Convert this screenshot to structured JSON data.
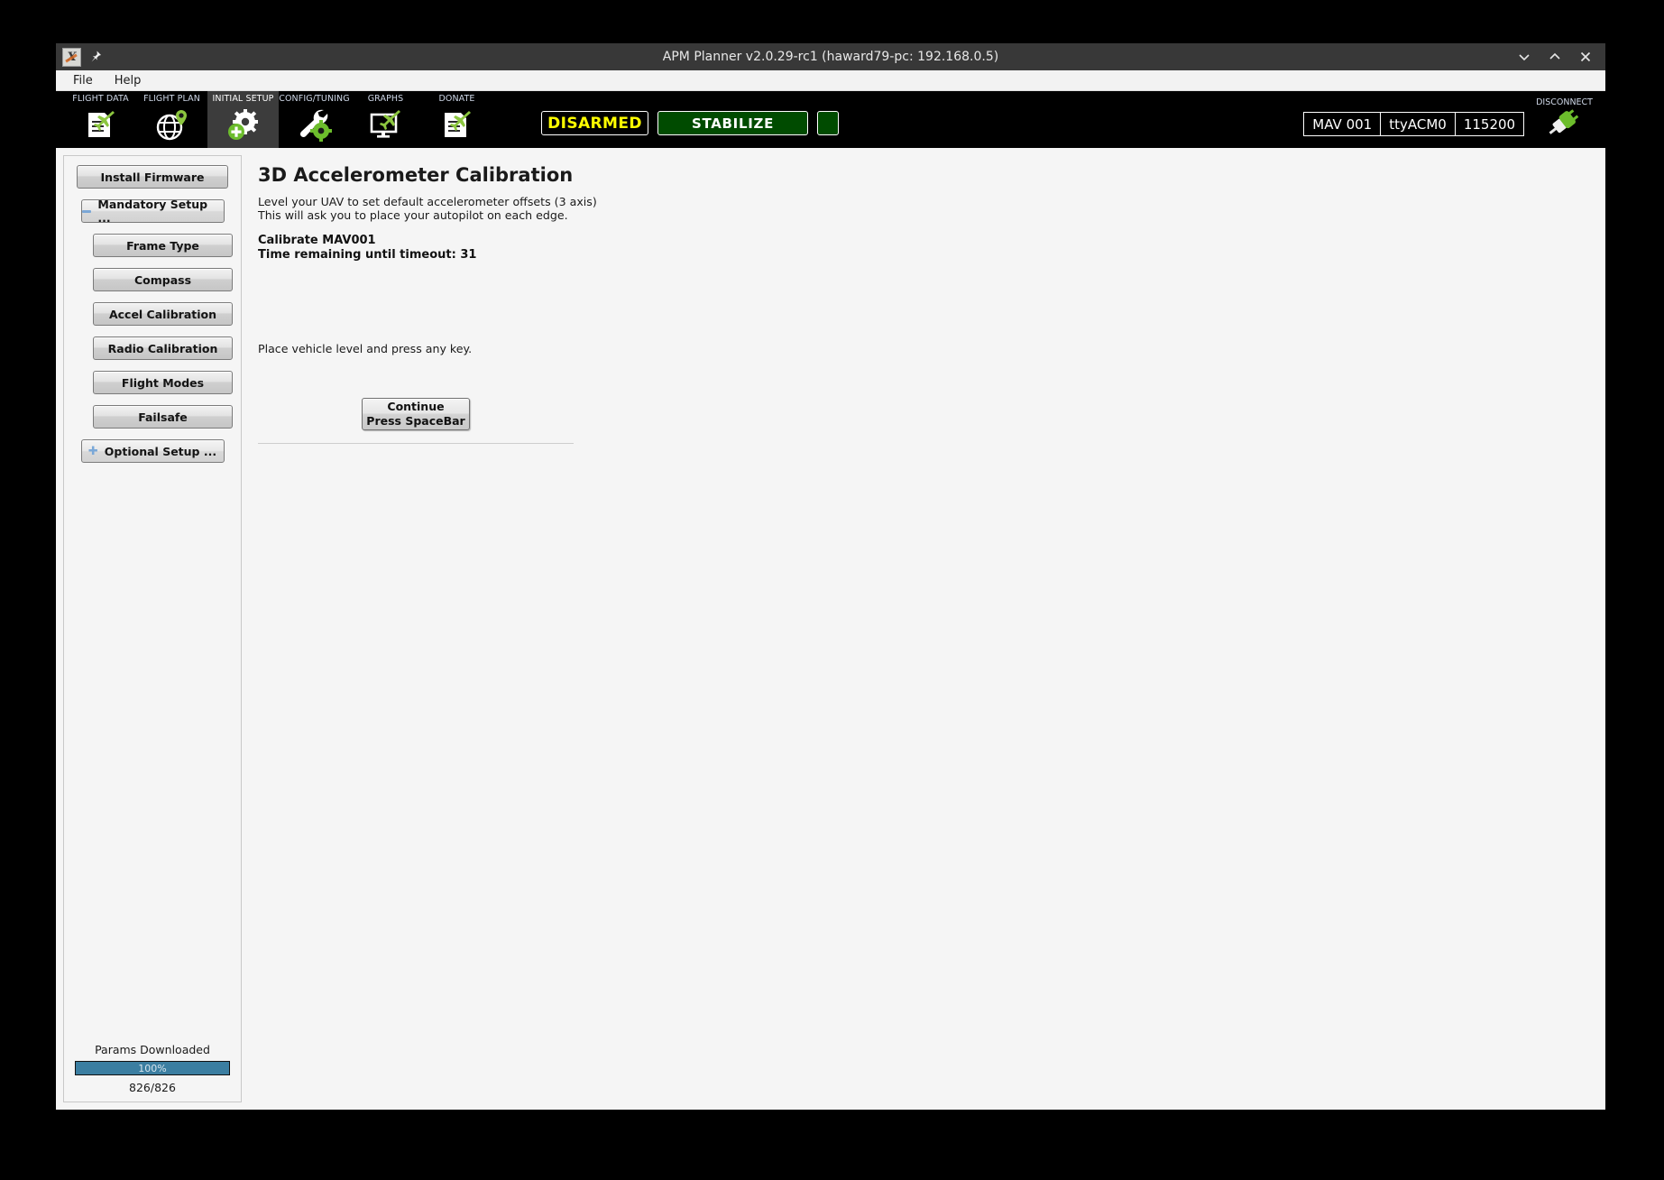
{
  "window": {
    "title": "APM Planner v2.0.29-rc1 (haward79-pc: 192.168.0.5)",
    "app_icon": "apm-app-icon",
    "pin_icon": "pin-icon",
    "controls": {
      "minimize": "chevron-down-icon",
      "maximize": "chevron-up-icon",
      "close": "close-icon"
    }
  },
  "menubar": {
    "items": [
      {
        "label": "File"
      },
      {
        "label": "Help"
      }
    ]
  },
  "toolbar": {
    "tabs": [
      {
        "label": "FLIGHT DATA",
        "icon": "document-plane-icon",
        "active": false
      },
      {
        "label": "FLIGHT PLAN",
        "icon": "globe-pin-icon",
        "active": false
      },
      {
        "label": "INITIAL SETUP",
        "icon": "gear-plus-icon",
        "active": true
      },
      {
        "label": "CONFIG/TUNING",
        "icon": "wrench-gear-icon",
        "active": false
      },
      {
        "label": "GRAPHS",
        "icon": "monitor-plane-icon",
        "active": false
      },
      {
        "label": "DONATE",
        "icon": "document-plane-icon",
        "active": false
      }
    ],
    "status": {
      "armed_state": "DISARMED",
      "flight_mode": "STABILIZE",
      "indicator": "",
      "armed_color": "#ffff00",
      "mode_bg_color": "#004b00"
    },
    "connection": {
      "mav_id": "MAV 001",
      "port": "ttyACM0",
      "baud": "115200",
      "disconnect_label": "DISCONNECT",
      "disconnect_icon": "plug-connected-icon"
    }
  },
  "sidebar": {
    "buttons": [
      {
        "label": "Install Firmware",
        "style": "wide",
        "icon": ""
      },
      {
        "label": "Mandatory Setup ...",
        "style": "group",
        "icon": "minus-expander-icon"
      },
      {
        "label": "Frame Type",
        "style": "sub",
        "icon": ""
      },
      {
        "label": "Compass",
        "style": "sub",
        "icon": ""
      },
      {
        "label": "Accel Calibration",
        "style": "sub",
        "icon": ""
      },
      {
        "label": "Radio Calibration",
        "style": "sub",
        "icon": ""
      },
      {
        "label": "Flight Modes",
        "style": "sub",
        "icon": ""
      },
      {
        "label": "Failsafe",
        "style": "sub",
        "icon": ""
      },
      {
        "label": "Optional Setup ...",
        "style": "group",
        "icon": "plus-expander-icon"
      }
    ],
    "progress": {
      "label": "Params Downloaded",
      "percent_text": "100%",
      "percent_value": 100,
      "count": "826/826",
      "bar_color": "#3b7ea1"
    }
  },
  "main": {
    "title": "3D Accelerometer Calibration",
    "description_line1": "Level your UAV to set default accelerometer offsets (3 axis)",
    "description_line2": "This will ask you to place your autopilot on each edge.",
    "calibrate_target": "Calibrate MAV001",
    "timeout_line": "Time remaining until timeout: 31",
    "instruction": "Place vehicle level and press any key.",
    "continue_button": {
      "line1": "Continue",
      "line2": "Press SpaceBar"
    }
  }
}
